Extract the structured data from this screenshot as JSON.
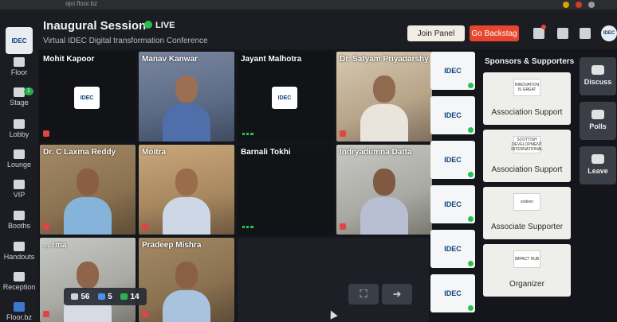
{
  "browser": {
    "url_fragment": "ajvi.floor.bz"
  },
  "sidebar": {
    "logo_text": "IDEC",
    "items": [
      {
        "label": "Floor",
        "icon": "map-icon"
      },
      {
        "label": "Stage",
        "icon": "camera-icon",
        "badge": "1"
      },
      {
        "label": "Lobby",
        "icon": "people-icon"
      },
      {
        "label": "Lounge",
        "icon": "handshake-icon"
      },
      {
        "label": "VIP",
        "icon": "mic-icon"
      },
      {
        "label": "Booths",
        "icon": "booth-icon"
      },
      {
        "label": "Handouts",
        "icon": "document-icon"
      },
      {
        "label": "Reception",
        "icon": "reception-icon"
      },
      {
        "label": "Floor.bz",
        "icon": "floorbz-icon"
      }
    ]
  },
  "header": {
    "title": "Inaugural Session",
    "live_label": "LIVE",
    "subtitle": "Virtual IDEC Digital transformation Conference",
    "join_panel_label": "Join Panel",
    "go_backstage_label": "Go Backstag",
    "avatar_text": "IDEC"
  },
  "participants": [
    {
      "name": "Mohit Kapoor",
      "video": false,
      "muted": true
    },
    {
      "name": "Manav Kanwar",
      "video": true,
      "muted": false
    },
    {
      "name": "Jayant Malhotra",
      "video": false,
      "muted": false
    },
    {
      "name": "Dr. Satyam Priyadarshy",
      "video": true,
      "muted": true
    },
    {
      "name": "Dr. C Laxma Reddy",
      "video": true,
      "muted": true
    },
    {
      "name": "Moitra",
      "video": true,
      "muted": true
    },
    {
      "name": "Barnali Tokhi",
      "video": false,
      "muted": false
    },
    {
      "name": "Indryadumna Datta",
      "video": true,
      "muted": true
    },
    {
      "name": "... rma",
      "video": true,
      "muted": true
    },
    {
      "name": "Pradeep Mishra",
      "video": true,
      "muted": true
    }
  ],
  "tile_logo_text": "IDEC",
  "stats": {
    "people": "56",
    "raised": "5",
    "likes": "14"
  },
  "logo_column": {
    "text": "IDEC"
  },
  "sponsors": {
    "heading": "Sponsors & Supporters",
    "items": [
      {
        "logo": "INNOVATION IS GREAT",
        "label": "Association Support"
      },
      {
        "logo": "SCOTTISH DEVELOPMENT INTERNATIONAL",
        "label": "Association Support"
      },
      {
        "logo": "sodexo",
        "label": "Associate Supporter"
      },
      {
        "logo": "IMPACT HUB",
        "label": "Organizer"
      }
    ]
  },
  "right_panel": {
    "discuss_label": "Discuss",
    "polls_label": "Polls",
    "leave_label": "Leave"
  },
  "colors": {
    "accent_live": "#26c14b",
    "backstage": "#e8452f",
    "join_panel": "#f1ede3",
    "background": "#14161b"
  }
}
